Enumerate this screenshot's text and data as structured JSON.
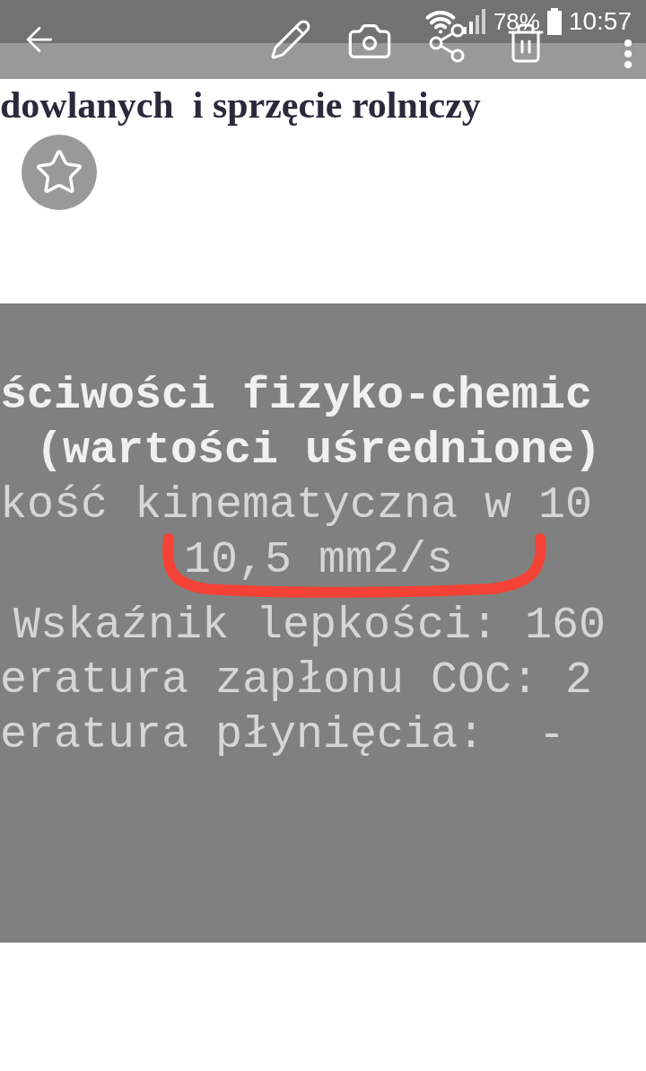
{
  "status_bar": {
    "battery": "78%",
    "time": "10:57"
  },
  "document": {
    "lines": [
      "dowlanych  i sprzęcie rolniczy"
    ]
  },
  "image_text": [
    {
      "text": "ściwości fizyko-chemic",
      "bold": true
    },
    {
      "text": "(wartości uśrednione)",
      "bold": true
    },
    {
      "text": "kość kinematyczna w 10",
      "bold": false
    },
    {
      "text": "10,5 mm2/s",
      "bold": false
    },
    {
      "text": "Wskaźnik lepkości: 160",
      "bold": false
    },
    {
      "text": "eratura zapłonu COC: 2",
      "bold": false
    },
    {
      "text": "eratura płynięcia:  -",
      "bold": false
    }
  ]
}
